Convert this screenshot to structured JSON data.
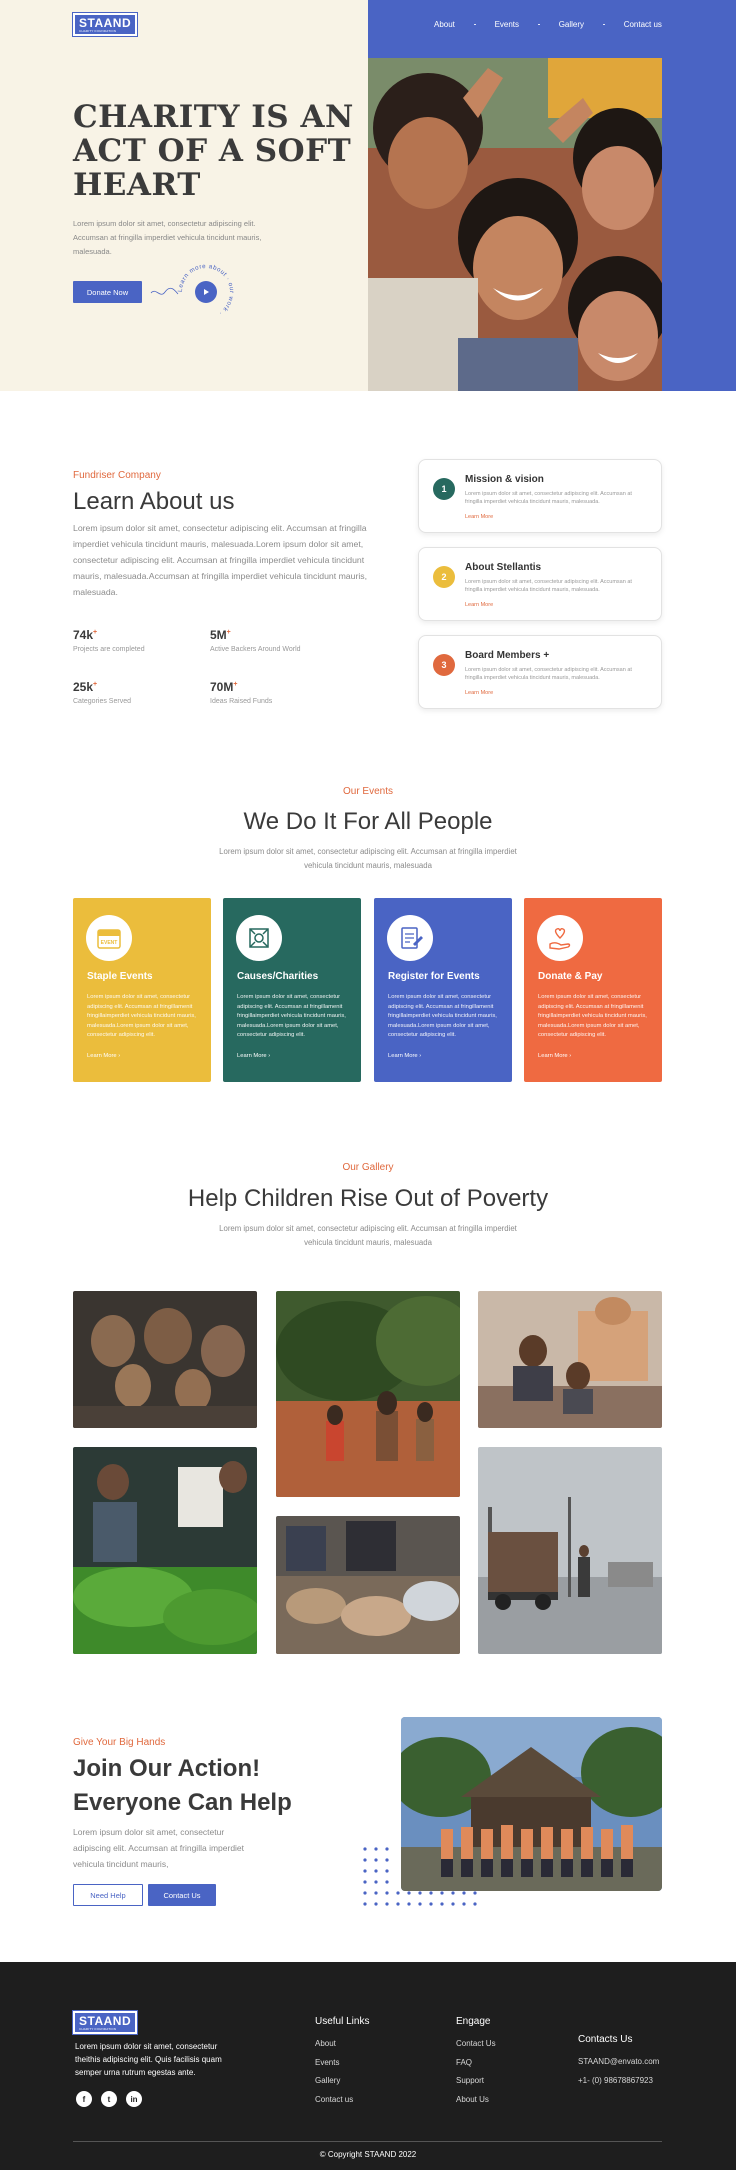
{
  "brand": {
    "logo": "STAAND",
    "logo_sub": "CHARITY FOUNDATION",
    "accent": "#4a64c4",
    "orange": "#e0693e"
  },
  "nav": {
    "items": [
      "About",
      "Events",
      "Gallery",
      "Contact us"
    ]
  },
  "hero": {
    "title": "CHARITY IS AN ACT OF A SOFT HEART",
    "text": "Lorem ipsum dolor sit amet, consectetur adipiscing elit. Accumsan at fringilla imperdiet vehicula tincidunt mauris, malesuada.",
    "button": "Donate Now",
    "ring_text": "Learn more about · our work ·"
  },
  "about": {
    "label": "Fundriser Company",
    "title": "Learn About us",
    "text": "Lorem ipsum dolor sit amet, consectetur adipiscing elit. Accumsan at fringilla imperdiet vehicula tincidunt mauris, malesuada.Lorem ipsum dolor sit amet, consectetur adipiscing elit. Accumsan at fringilla imperdiet vehicula tincidunt mauris, malesuada.Accumsan at fringilla imperdiet vehicula tincidunt mauris, malesuada.",
    "stats": [
      {
        "value": "74k",
        "label": "Projects are completed"
      },
      {
        "value": "5M",
        "label": "Active Backers Around World"
      },
      {
        "value": "25k",
        "label": "Categories Served"
      },
      {
        "value": "70M",
        "label": "Ideas Raised Funds"
      }
    ],
    "stat_suffix": "+",
    "cards": [
      {
        "num": "1",
        "title": "Mission & vision",
        "text": "Lorem ipsum dolor sit amet, consectetur adipiscing elit. Accumsan at fringilla imperdiet vehicula tincidunt mauris, malesuada.",
        "link": "Learn More",
        "color": "#27695f"
      },
      {
        "num": "2",
        "title": "About Stellantis",
        "text": "Lorem ipsum dolor sit amet, consectetur adipiscing elit. Accumsan at fringilla imperdiet vehicula tincidunt mauris, malesuada.",
        "link": "Learn More",
        "color": "#ebbd3c"
      },
      {
        "num": "3",
        "title": "Board Members +",
        "text": "Lorem ipsum dolor sit amet, consectetur adipiscing elit. Accumsan at fringilla imperdiet vehicula tincidunt mauris, malesuada.",
        "link": "Learn More",
        "color": "#e0693e"
      }
    ]
  },
  "events": {
    "label": "Our Events",
    "title": "We Do It For All People",
    "sub": "Lorem ipsum dolor sit amet, consectetur adipiscing elit. Accumsan at fringilla imperdiet vehicula tincidunt mauris, malesuada",
    "cards": [
      {
        "title": "Staple Events",
        "text": "Lorem ipsum dolor sit amet, consectetur adipiscing elit. Accumsan at fringillamenit fringillaimperdiet vehicula tincidunt mauris, malesuada.Lorem ipsum dolor sit amet, consectetur adipiscing elit.",
        "link": "Learn More",
        "color": "#ebbd3c",
        "icon": "calendar-icon",
        "badge": "EVENT"
      },
      {
        "title": "Causes/Charities",
        "text": "Lorem ipsum dolor sit amet, consectetur adipiscing elit. Accumsan at fringillamenit fringillaimperdiet vehicula tincidunt mauris, malesuada.Lorem ipsum dolor sit amet, consectetur adipiscing elit.",
        "link": "Learn More",
        "color": "#27695f",
        "icon": "causes-icon"
      },
      {
        "title": "Register for Events",
        "text": "Lorem ipsum dolor sit amet, consectetur adipiscing elit. Accumsan at fringillamenit fringillaimperdiet vehicula tincidunt mauris, malesuada.Lorem ipsum dolor sit amet, consectetur adipiscing elit.",
        "link": "Learn More",
        "color": "#4a64c4",
        "icon": "register-icon"
      },
      {
        "title": "Donate & Pay",
        "text": "Lorem ipsum dolor sit amet, consectetur adipiscing elit. Accumsan at fringillamenit fringillaimperdiet vehicula tincidunt mauris, malesuada.Lorem ipsum dolor sit amet, consectetur adipiscing elit.",
        "link": "Learn More",
        "color": "#ef6a41",
        "icon": "donate-icon"
      }
    ]
  },
  "gallery": {
    "label": "Our Gallery",
    "title": "Help Children Rise Out of Poverty",
    "sub": "Lorem ipsum dolor sit amet, consectetur adipiscing elit. Accumsan at fringilla imperdiet vehicula tincidunt mauris, malesuada"
  },
  "action": {
    "label": "Give Your Big Hands",
    "title_line1": "Join Our Action!",
    "title_line2": "Everyone Can Help",
    "text": "Lorem ipsum dolor sit amet, consectetur adipiscing elit. Accumsan at fringilla imperdiet vehicula tincidunt mauris,",
    "btn_help": "Need Help",
    "btn_contact": "Contact Us"
  },
  "footer": {
    "about": "Lorem ipsum dolor sit amet, consectetur theithis adipiscing elit. Quis facilisis quam semper urna rutrum egestas ante.",
    "useful_title": "Useful Links",
    "useful": [
      "About",
      "Events",
      "Gallery",
      "Contact us"
    ],
    "engage_title": "Engage",
    "engage": [
      "Contact Us",
      "FAQ",
      "Support",
      "About Us"
    ],
    "contacts_title": "Contacts Us",
    "email": "STAAND@envato.com",
    "phone": "+1- (0) 98678867923",
    "copyright_prefix": "© Copyright",
    "copyright_brand": "STAAND 2022",
    "socials": [
      "f",
      "t",
      "in"
    ]
  }
}
